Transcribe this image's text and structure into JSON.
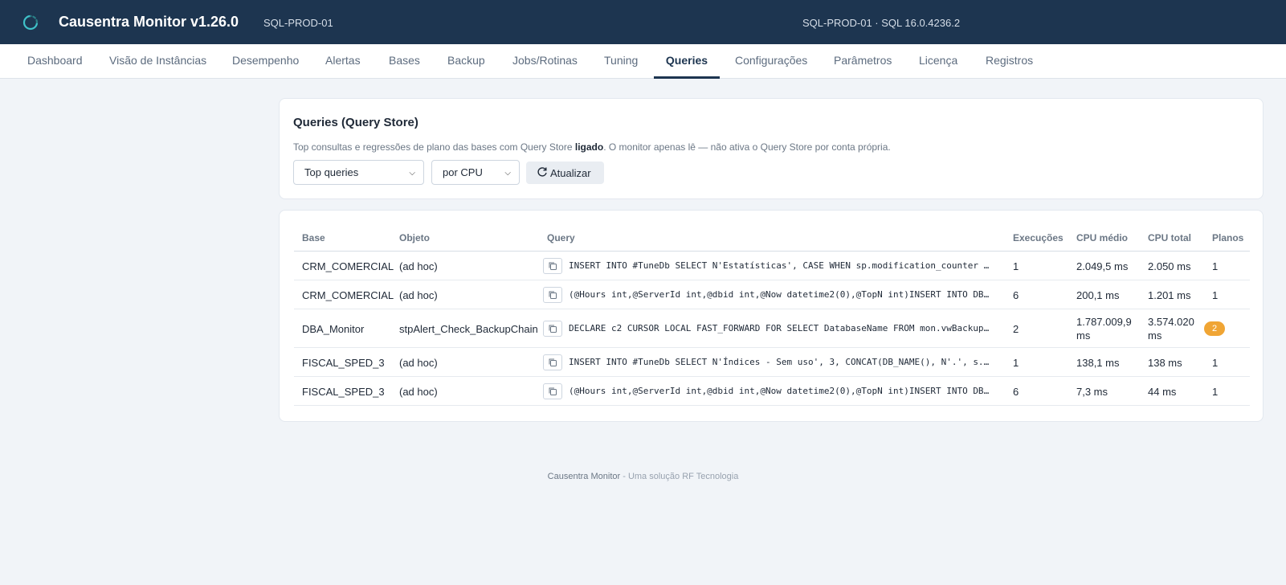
{
  "header": {
    "app_title": "Causentra Monitor v1.26.0",
    "server": "SQL-PROD-01",
    "server_info": "SQL-PROD-01 · SQL 16.0.4236.2",
    "logo_icon": "spinner-logo-icon",
    "background": "#1d3550"
  },
  "nav": {
    "tabs": [
      {
        "label": "Dashboard"
      },
      {
        "label": "Visão de Instâncias"
      },
      {
        "label": "Desempenho"
      },
      {
        "label": "Alertas"
      },
      {
        "label": "Bases"
      },
      {
        "label": "Backup"
      },
      {
        "label": "Jobs/Rotinas"
      },
      {
        "label": "Tuning"
      },
      {
        "label": "Queries"
      },
      {
        "label": "Configurações"
      },
      {
        "label": "Parâmetros"
      },
      {
        "label": "Licença"
      },
      {
        "label": "Registros"
      }
    ],
    "active": "Queries"
  },
  "panel": {
    "title": "Queries (Query Store)",
    "desc_before": "Top consultas e regressões de plano das bases com Query Store ",
    "desc_bold": "ligado",
    "desc_after": ". O monitor apenas lê — não ativa o Query Store por conta própria.",
    "mode_select": "Top queries",
    "order_select": "por CPU",
    "refresh_label": "Atualizar",
    "refresh_icon": "refresh-icon"
  },
  "table": {
    "columns": {
      "base": "Base",
      "objeto": "Objeto",
      "query": "Query",
      "execucoes": "Execuções",
      "cpu_medio": "CPU médio",
      "cpu_total": "CPU total",
      "planos": "Planos"
    },
    "rows": [
      {
        "base": "CRM_COMERCIAL",
        "objeto": "(ad hoc)",
        "query": "INSERT INTO #TuneDb SELECT N'Estatísticas', CASE WHEN sp.modification_counter >…",
        "execucoes": "1",
        "cpu_medio": "2.049,5 ms",
        "cpu_total": "2.050 ms",
        "planos": "1"
      },
      {
        "base": "CRM_COMERCIAL",
        "objeto": "(ad hoc)",
        "query": "(@Hours int,@ServerId int,@dbid int,@Now datetime2(0),@TopN int)INSERT INTO DBA…",
        "execucoes": "6",
        "cpu_medio": "200,1 ms",
        "cpu_total": "1.201 ms",
        "planos": "1"
      },
      {
        "base": "DBA_Monitor",
        "objeto": "stpAlert_Check_BackupChain",
        "query": "DECLARE c2 CURSOR LOCAL FAST_FORWARD FOR SELECT DatabaseName FROM mon.vwBackupC…",
        "execucoes": "2",
        "cpu_medio": "1.787.009,9 ms",
        "cpu_total": "3.574.020 ms",
        "planos": "2"
      },
      {
        "base": "FISCAL_SPED_3",
        "objeto": "(ad hoc)",
        "query": "INSERT INTO #TuneDb SELECT N'Índices - Sem uso', 3, CONCAT(DB_NAME(), N'.', s.n…",
        "execucoes": "1",
        "cpu_medio": "138,1 ms",
        "cpu_total": "138 ms",
        "planos": "1"
      },
      {
        "base": "FISCAL_SPED_3",
        "objeto": "(ad hoc)",
        "query": "(@Hours int,@ServerId int,@dbid int,@Now datetime2(0),@TopN int)INSERT INTO DBA…",
        "execucoes": "6",
        "cpu_medio": "7,3 ms",
        "cpu_total": "44 ms",
        "planos": "1"
      }
    ],
    "copy_icon": "copy-icon",
    "badge_color": "#f0a534"
  },
  "footer": {
    "brand": "Causentra Monitor",
    "tagline": " - Uma solução RF Tecnologia"
  }
}
